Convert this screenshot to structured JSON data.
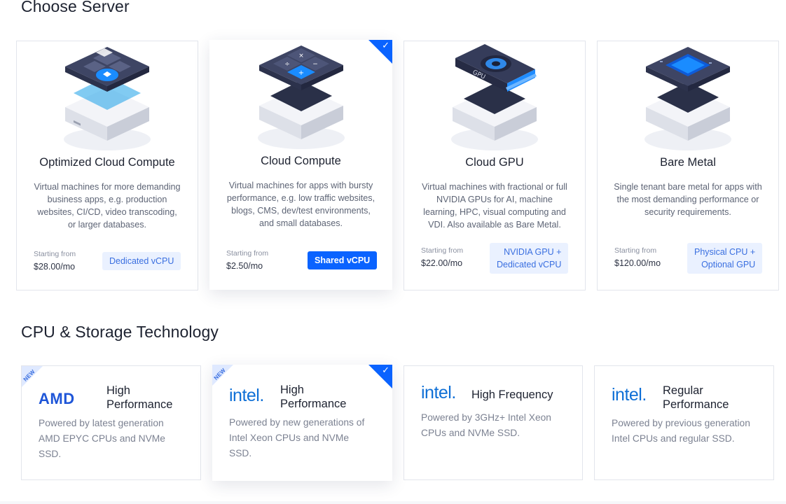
{
  "sections": {
    "server_title": "Choose Server",
    "tech_title": "CPU & Storage Technology"
  },
  "servers": [
    {
      "name": "Optimized Cloud Compute",
      "desc": "Virtual machines for more demanding business apps, e.g. production websites, CI/CD, video transcoding, or larger databases.",
      "from_label": "Starting from",
      "price": "$28.00/mo",
      "tag": "Dedicated vCPU",
      "selected": false,
      "icon": "chip-server-icon"
    },
    {
      "name": "Cloud Compute",
      "desc": "Virtual machines for apps with bursty performance, e.g. low traffic websites, blogs, CMS, dev/test environments, and small databases.",
      "from_label": "Starting from",
      "price": "$2.50/mo",
      "tag": "Shared vCPU",
      "selected": true,
      "icon": "calculator-server-icon"
    },
    {
      "name": "Cloud GPU",
      "desc": "Virtual machines with fractional or full NVIDIA GPUs for AI, machine learning, HPC, visual computing and VDI. Also available as Bare Metal.",
      "from_label": "Starting from",
      "price": "$22.00/mo",
      "tag_line1": "NVIDIA GPU +",
      "tag_line2": "Dedicated vCPU",
      "selected": false,
      "icon": "gpu-server-icon"
    },
    {
      "name": "Bare Metal",
      "desc": "Single tenant bare metal for apps with the most demanding performance or security requirements.",
      "from_label": "Starting from",
      "price": "$120.00/mo",
      "tag_line1": "Physical CPU +",
      "tag_line2": "Optional GPU",
      "selected": false,
      "icon": "bare-metal-server-icon"
    }
  ],
  "tech": [
    {
      "logo": "AMD",
      "badge": "NEW",
      "name_line1": "High",
      "name_line2": "Performance",
      "desc_lines": [
        "Powered by latest generation",
        "AMD EPYC CPUs and NVMe",
        "SSD."
      ],
      "selected": false
    },
    {
      "logo": "intel.",
      "badge": "NEW",
      "name_line1": "High",
      "name_line2": "Performance",
      "desc_lines": [
        "Powered by new generations of",
        "Intel Xeon CPUs and NVMe",
        "SSD."
      ],
      "selected": true
    },
    {
      "logo": "intel.",
      "name_line1": "High Frequency",
      "desc_lines": [
        "Powered by 3GHz+ Intel Xeon",
        "CPUs and NVMe SSD."
      ],
      "selected": false
    },
    {
      "logo": "intel.",
      "name_line1": "Regular",
      "name_line2": "Performance",
      "desc_lines": [
        "Powered by previous generation",
        "Intel CPUs and regular SSD."
      ],
      "selected": false
    }
  ],
  "colors": {
    "accent": "#0a63ff",
    "tag_bg": "#eaf1ff",
    "tag_text": "#3a6fe0"
  }
}
